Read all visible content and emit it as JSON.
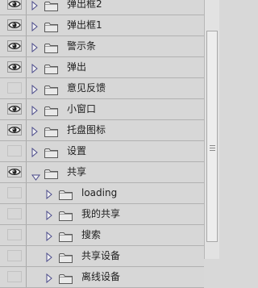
{
  "layers": [
    {
      "name": "弹出框2",
      "visible": true,
      "expanded": false,
      "indent": 0
    },
    {
      "name": "弹出框1",
      "visible": true,
      "expanded": false,
      "indent": 0
    },
    {
      "name": "警示条",
      "visible": true,
      "expanded": false,
      "indent": 0
    },
    {
      "name": "弹出",
      "visible": true,
      "expanded": false,
      "indent": 0
    },
    {
      "name": "意见反馈",
      "visible": false,
      "expanded": false,
      "indent": 0
    },
    {
      "name": "小窗口",
      "visible": true,
      "expanded": false,
      "indent": 0
    },
    {
      "name": "托盘图标",
      "visible": true,
      "expanded": false,
      "indent": 0
    },
    {
      "name": "设置",
      "visible": false,
      "expanded": false,
      "indent": 0
    },
    {
      "name": "共享",
      "visible": true,
      "expanded": true,
      "indent": 0
    },
    {
      "name": "loading",
      "visible": false,
      "expanded": false,
      "indent": 1
    },
    {
      "name": "我的共享",
      "visible": false,
      "expanded": false,
      "indent": 1
    },
    {
      "name": "搜索",
      "visible": false,
      "expanded": false,
      "indent": 1
    },
    {
      "name": "共享设备",
      "visible": false,
      "expanded": false,
      "indent": 1
    },
    {
      "name": "离线设备",
      "visible": false,
      "expanded": false,
      "indent": 1
    }
  ],
  "colors": {
    "eye": "#222222",
    "row_bg": "#d7d7d7",
    "triangle_collapsed": "#4a4a8a",
    "triangle_expanded": "#4a4a8a"
  },
  "icons": {
    "visibility": "eye-icon",
    "expand": "disclosure-triangle-icon",
    "group": "folder-icon"
  }
}
